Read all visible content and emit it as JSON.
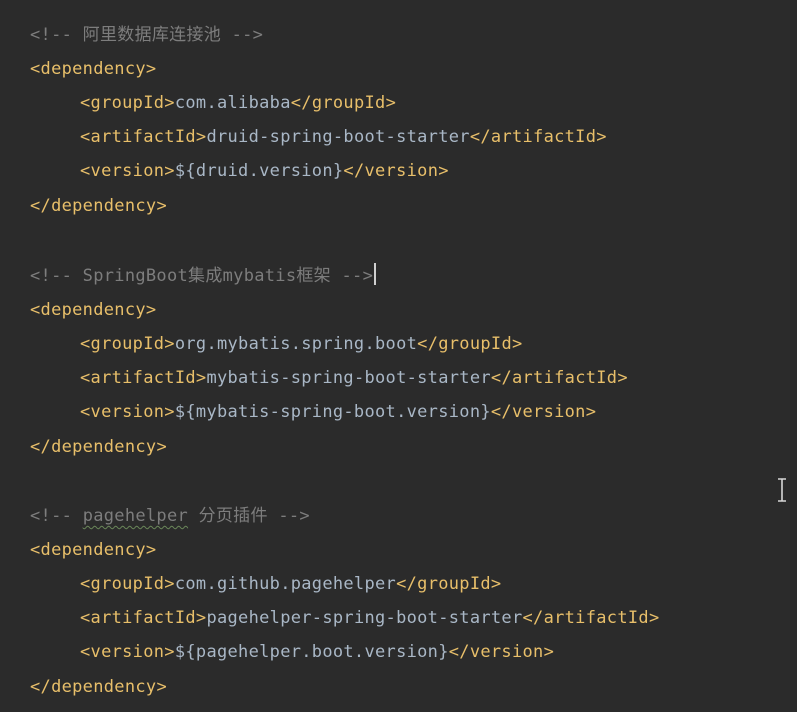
{
  "editor": {
    "lines": [
      {
        "kind": "comment",
        "text": "<!-- 阿里数据库连接池 -->"
      },
      {
        "kind": "open",
        "tag": "dependency"
      },
      {
        "kind": "element",
        "tag": "groupId",
        "value": "com.alibaba"
      },
      {
        "kind": "element",
        "tag": "artifactId",
        "value": "druid-spring-boot-starter"
      },
      {
        "kind": "element",
        "tag": "version",
        "value": "${druid.version}"
      },
      {
        "kind": "close",
        "tag": "dependency"
      },
      {
        "kind": "comment",
        "text": "<!-- SpringBoot集成mybatis框架 -->"
      },
      {
        "kind": "open",
        "tag": "dependency"
      },
      {
        "kind": "element",
        "tag": "groupId",
        "value": "org.mybatis.spring.boot"
      },
      {
        "kind": "element",
        "tag": "artifactId",
        "value": "mybatis-spring-boot-starter"
      },
      {
        "kind": "element",
        "tag": "version",
        "value": "${mybatis-spring-boot.version}"
      },
      {
        "kind": "close",
        "tag": "dependency"
      },
      {
        "kind": "comment",
        "prefix": "<!-- ",
        "squiggle": "pagehelper",
        "suffix": " 分页插件 -->"
      },
      {
        "kind": "open",
        "tag": "dependency"
      },
      {
        "kind": "element",
        "tag": "groupId",
        "value": "com.github.pagehelper"
      },
      {
        "kind": "element",
        "tag": "artifactId",
        "value": "pagehelper-spring-boot-starter"
      },
      {
        "kind": "element",
        "tag": "version",
        "value": "${pagehelper.boot.version}"
      },
      {
        "kind": "close",
        "tag": "dependency"
      }
    ]
  },
  "colors": {
    "background": "#2b2b2b",
    "comment": "#7d7d7d",
    "tag": "#e8bf6a",
    "text": "#a9b7c6"
  },
  "icons": {
    "cursor": "text-cursor-icon"
  }
}
